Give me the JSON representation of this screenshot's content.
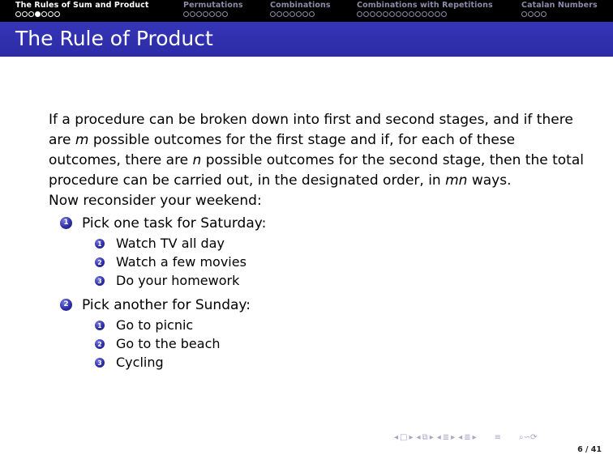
{
  "navbar": {
    "sections": [
      {
        "title": "The Rules of Sum and Product",
        "dots": 7,
        "current": 3,
        "active": true
      },
      {
        "title": "Permutations",
        "dots": 7,
        "current": -1,
        "active": false
      },
      {
        "title": "Combinations",
        "dots": 7,
        "current": -1,
        "active": false
      },
      {
        "title": "Combinations with Repetitions",
        "dots": 14,
        "current": -1,
        "active": false
      },
      {
        "title": "Catalan Numbers",
        "dots": 4,
        "current": -1,
        "active": false
      }
    ]
  },
  "frame": {
    "title": "The Rule of Product"
  },
  "body": {
    "para_part1": "If a procedure can be broken down into first and second stages, and if there are ",
    "var_m": "m",
    "para_part2": " possible outcomes for the first stage and if, for each of these outcomes, there are ",
    "var_n": "n",
    "para_part3": " possible outcomes for the second stage, then the total procedure can be carried out, in the designated order, in ",
    "var_mn": "mn",
    "para_part4": " ways.",
    "intro": "Now reconsider your weekend:",
    "list": [
      {
        "num": "1",
        "label": "Pick one task for Saturday:",
        "subitems": [
          {
            "num": "1",
            "label": "Watch TV all day"
          },
          {
            "num": "2",
            "label": "Watch a few movies"
          },
          {
            "num": "3",
            "label": "Do your homework"
          }
        ]
      },
      {
        "num": "2",
        "label": "Pick another for Sunday:",
        "subitems": [
          {
            "num": "1",
            "label": "Go to picnic"
          },
          {
            "num": "2",
            "label": "Go to the beach"
          },
          {
            "num": "3",
            "label": "Cycling"
          }
        ]
      }
    ]
  },
  "footer": {
    "page_number": "6 / 41",
    "nav_icons": [
      "prev-arrow-icon",
      "frame-icon",
      "next-arrow-icon",
      "prev-arrow-icon",
      "subsection-icon",
      "next-arrow-icon",
      "prev-arrow-icon",
      "section-icon",
      "next-arrow-icon",
      "prev-arrow-icon",
      "section-icon",
      "next-arrow-icon",
      "align-icon",
      "search-icon"
    ]
  },
  "colors": {
    "title_bar": "#3333b3",
    "nav_bar": "#000000",
    "inactive_nav": "#8c8ca8"
  }
}
